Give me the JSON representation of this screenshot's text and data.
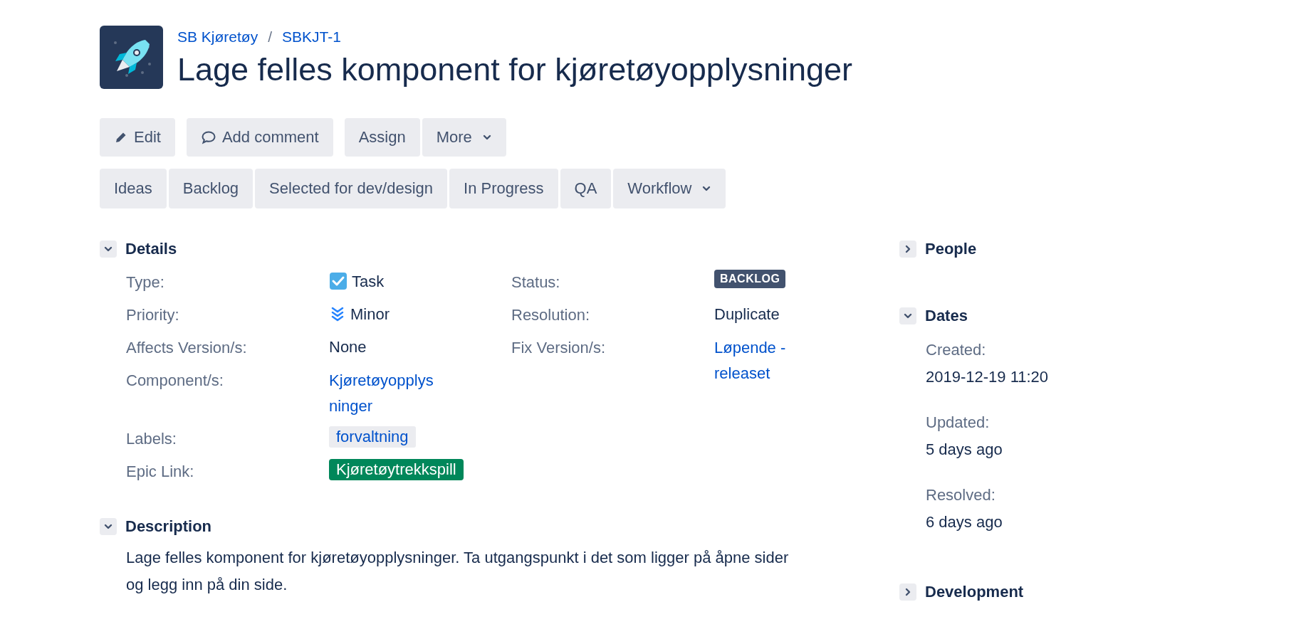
{
  "breadcrumbs": [
    {
      "label": "SB Kjøretøy"
    },
    {
      "label": "SBKJT-1"
    }
  ],
  "breadcrumb_separator": "/",
  "title": "Lage felles komponent for kjøretøyopplysninger",
  "action_groups": [
    [
      {
        "label": "Edit",
        "kind": "edit"
      }
    ],
    [
      {
        "label": "Add comment",
        "kind": "comment"
      }
    ],
    [
      {
        "label": "Assign",
        "kind": "plain"
      },
      {
        "label": "More",
        "kind": "menu"
      }
    ]
  ],
  "workflow_buttons": [
    {
      "label": "Ideas",
      "kind": "plain"
    },
    {
      "label": "Backlog",
      "kind": "plain"
    },
    {
      "label": "Selected for dev/design",
      "kind": "plain"
    },
    {
      "label": "In Progress",
      "kind": "plain"
    },
    {
      "label": "QA",
      "kind": "plain"
    },
    {
      "label": "Workflow",
      "kind": "menu"
    }
  ],
  "details": {
    "title": "Details",
    "expanded": true,
    "columns": [
      [
        {
          "label": "Type:",
          "kind": "type",
          "value": "Task"
        },
        {
          "label": "Priority:",
          "kind": "priority",
          "value": "Minor"
        },
        {
          "label": "Affects Version/s:",
          "kind": "text",
          "value": "None"
        },
        {
          "label": "Component/s:",
          "kind": "link",
          "value": "Kjøretøyopplysninger"
        },
        {
          "label": "Labels:",
          "kind": "label",
          "value": "forvaltning"
        },
        {
          "label": "Epic Link:",
          "kind": "epic",
          "value": "Kjøretøytrekkspill",
          "color": "#00875a"
        }
      ],
      [
        {
          "label": "Status:",
          "kind": "status",
          "value": "BACKLOG"
        },
        {
          "label": "Resolution:",
          "kind": "text",
          "value": "Duplicate"
        },
        {
          "label": "Fix Version/s:",
          "kind": "link",
          "value": "Løpende - releaset"
        }
      ]
    ]
  },
  "description": {
    "title": "Description",
    "expanded": true,
    "text": "Lage felles komponent for kjøretøyopplysninger. Ta utgangspunkt i det som ligger på åpne sider og legg inn på din side."
  },
  "side_sections": [
    {
      "title": "People",
      "expanded": false
    },
    {
      "title": "Dates",
      "expanded": true,
      "fields": [
        {
          "label": "Created:",
          "value": "2019-12-19 11:20"
        },
        {
          "label": "Updated:",
          "value": "5 days ago"
        },
        {
          "label": "Resolved:",
          "value": "6 days ago"
        }
      ]
    },
    {
      "title": "Development",
      "expanded": false
    }
  ]
}
